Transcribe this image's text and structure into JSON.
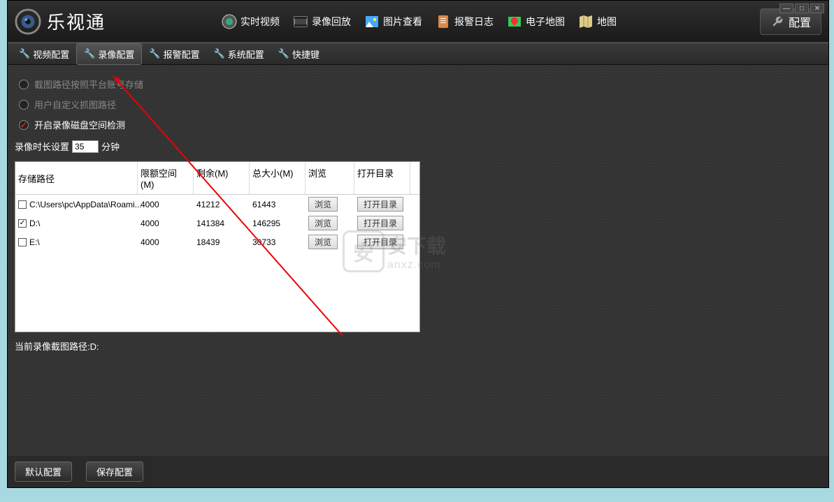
{
  "app": {
    "title": "乐视通"
  },
  "window_controls": {
    "min": "—",
    "max": "□",
    "close": "✕"
  },
  "nav": {
    "items": [
      {
        "label": "实时视频"
      },
      {
        "label": "录像回放"
      },
      {
        "label": "图片查看"
      },
      {
        "label": "报警日志"
      },
      {
        "label": "电子地图"
      },
      {
        "label": "地图"
      }
    ],
    "config_label": "配置"
  },
  "subnav": {
    "items": [
      {
        "label": "视频配置",
        "active": false
      },
      {
        "label": "录像配置",
        "active": true
      },
      {
        "label": "报警配置",
        "active": false
      },
      {
        "label": "系统配置",
        "active": false
      },
      {
        "label": "快捷键",
        "active": false
      }
    ]
  },
  "checks": {
    "screenshot_by_account": "截图路径按照平台账号存储",
    "custom_screenshot_path": "用户自定义抓图路径",
    "disk_space_check": "开启录像磁盘空间检测"
  },
  "duration": {
    "label_before": "录像时长设置",
    "value": "35",
    "label_after": "分钟"
  },
  "table": {
    "headers": {
      "path": "存储路径",
      "limit": "限额空间(M)",
      "remain": "剩余(M)",
      "total": "总大小(M)",
      "browse": "浏览",
      "open": "打开目录"
    },
    "rows": [
      {
        "checked": false,
        "path": "C:\\Users\\pc\\AppData\\Roami...",
        "limit": "4000",
        "remain": "41212",
        "total": "61443",
        "browse": "浏览",
        "open": "打开目录"
      },
      {
        "checked": true,
        "path": "D:\\",
        "limit": "4000",
        "remain": "141384",
        "total": "146295",
        "browse": "浏览",
        "open": "打开目录"
      },
      {
        "checked": false,
        "path": "E:\\",
        "limit": "4000",
        "remain": "18439",
        "total": "30733",
        "browse": "浏览",
        "open": "打开目录"
      }
    ]
  },
  "current_path": {
    "label": "当前录像截图路径:",
    "value": "D:"
  },
  "footer": {
    "default": "默认配置",
    "save": "保存配置"
  },
  "watermark": {
    "char": "安",
    "cn": "安下载",
    "en": "anxz.com"
  }
}
